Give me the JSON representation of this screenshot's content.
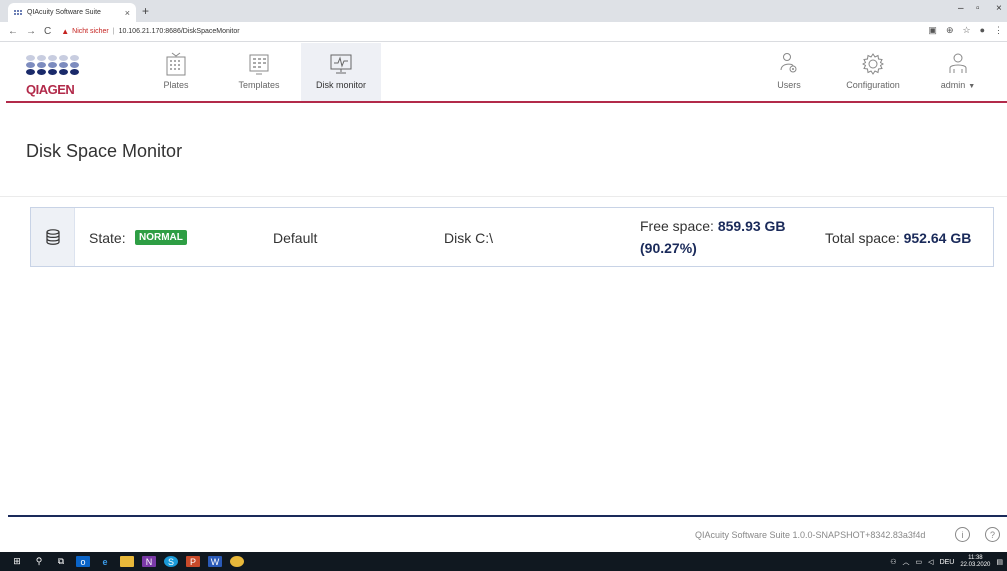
{
  "browser": {
    "tab_title": "QIAcuity Software Suite",
    "tab_close": "×",
    "new_tab": "+",
    "security_warning": "Nicht sicher",
    "url": "10.106.21.170:8686/DiskSpaceMonitor",
    "back": "←",
    "forward": "→",
    "reload": "C",
    "minimize": "–",
    "maximize": "▫",
    "close": "×"
  },
  "header": {
    "logo_text": "QIAGEN",
    "nav": [
      {
        "label": "Plates",
        "icon": "plate-icon"
      },
      {
        "label": "Templates",
        "icon": "template-icon"
      },
      {
        "label": "Disk monitor",
        "icon": "disk-monitor-icon",
        "active": true
      },
      {
        "label": "Users",
        "icon": "users-icon"
      },
      {
        "label": "Configuration",
        "icon": "gear-icon"
      },
      {
        "label": "admin",
        "icon": "user-icon"
      }
    ],
    "accent_color": "#b22a4a"
  },
  "page": {
    "title": "Disk Space Monitor"
  },
  "disk": {
    "state_label": "State:",
    "state_value": "NORMAL",
    "state_color": "#2e9e44",
    "name": "Default",
    "drive": "Disk C:\\",
    "free_label": "Free space:",
    "free_value": "859.93 GB",
    "free_percent": "(90.27%)",
    "total_label": "Total space:",
    "total_value": "952.64 GB"
  },
  "footer": {
    "version": "QIAcuity Software Suite 1.0.0-SNAPSHOT+8342.83a3f4d",
    "info": "i",
    "help": "?"
  },
  "taskbar": {
    "language": "DEU",
    "time": "11:38",
    "date": "22.03.2020"
  }
}
